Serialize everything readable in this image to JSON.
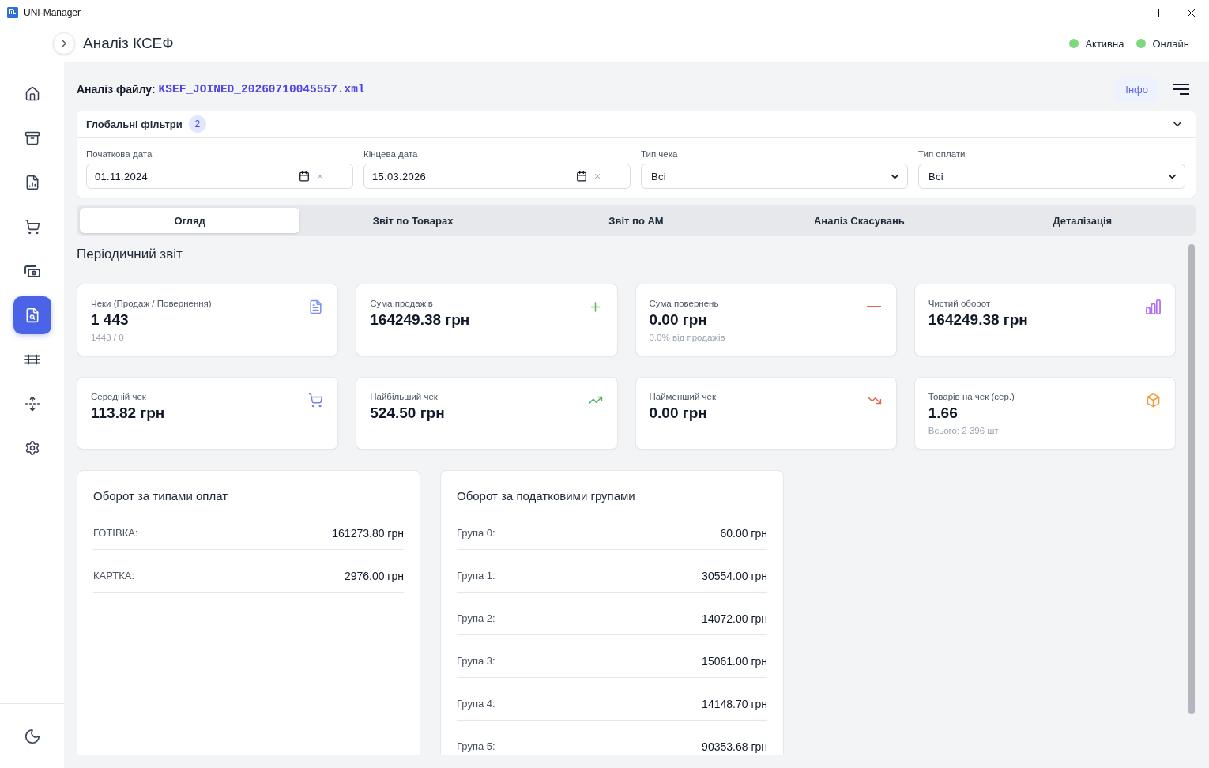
{
  "window": {
    "title": "UNI-Manager"
  },
  "header": {
    "title": "Аналіз КСЕФ",
    "statuses": [
      {
        "label": "Активна",
        "color": "#7dd87f"
      },
      {
        "label": "Онлайн",
        "color": "#7dd87f"
      }
    ]
  },
  "sidebar": {
    "items": [
      {
        "selected": false
      },
      {
        "selected": false
      },
      {
        "selected": false
      },
      {
        "selected": false
      },
      {
        "selected": false
      },
      {
        "selected": true
      },
      {
        "selected": false
      },
      {
        "selected": false
      },
      {
        "selected": false
      }
    ]
  },
  "file": {
    "label": "Аналіз файлу:",
    "name": "KSEF_JOINED_20260710045557.xml"
  },
  "info_button": "Інфо",
  "filters": {
    "title": "Глобальні фільтри",
    "count": "2",
    "expanded": true,
    "fields": [
      {
        "kind": "date",
        "label": "Початкова дата",
        "value": "01.11.2024"
      },
      {
        "kind": "date",
        "label": "Кінцева дата",
        "value": "15.03.2026"
      },
      {
        "kind": "select",
        "label": "Тип чека",
        "value": "Всі"
      },
      {
        "kind": "select",
        "label": "Тип оплати",
        "value": "Всі"
      }
    ]
  },
  "tabs": [
    {
      "label": "Огляд",
      "selected": true
    },
    {
      "label": "Звіт по Товарах",
      "selected": false
    },
    {
      "label": "Звіт по АМ",
      "selected": false
    },
    {
      "label": "Аналіз Скасувань",
      "selected": false
    },
    {
      "label": "Деталізація",
      "selected": false
    }
  ],
  "section_title": "Періодичний звіт",
  "stats": [
    {
      "label": "Чеки (Продаж / Повернення)",
      "value": "1 443",
      "note": "1443 / 0"
    },
    {
      "label": "Сума продажів",
      "value": "164249.38 грн"
    },
    {
      "label": "Сума повернень",
      "value": "0.00 грн",
      "note": "0.0% від продажів"
    },
    {
      "label": "Чистий оборот",
      "value": "164249.38 грн"
    },
    {
      "label": "Середній чек",
      "value": "113.82 грн"
    },
    {
      "label": "Найбільший чек",
      "value": "524.50 грн"
    },
    {
      "label": "Найменший чек",
      "value": "0.00 грн"
    },
    {
      "label": "Товарів на чек (сер.)",
      "value": "1.66",
      "note": "Всього: 2 396 шт"
    }
  ],
  "payment_turnover": {
    "title": "Оборот за типами оплат",
    "rows": [
      {
        "label": "ГОТІВКА:",
        "value": "161273.80 грн"
      },
      {
        "label": "КАРТКА:",
        "value": "2976.00 грн"
      }
    ]
  },
  "tax_turnover": {
    "title": "Оборот за податковими групами",
    "rows": [
      {
        "label": "Група 0:",
        "value": "60.00 грн"
      },
      {
        "label": "Група 1:",
        "value": "30554.00 грн"
      },
      {
        "label": "Група 2:",
        "value": "14072.00 грн"
      },
      {
        "label": "Група 3:",
        "value": "15061.00 грн"
      },
      {
        "label": "Група 4:",
        "value": "14148.70 грн"
      },
      {
        "label": "Група 5:",
        "value": "90353.68 грн"
      }
    ]
  }
}
